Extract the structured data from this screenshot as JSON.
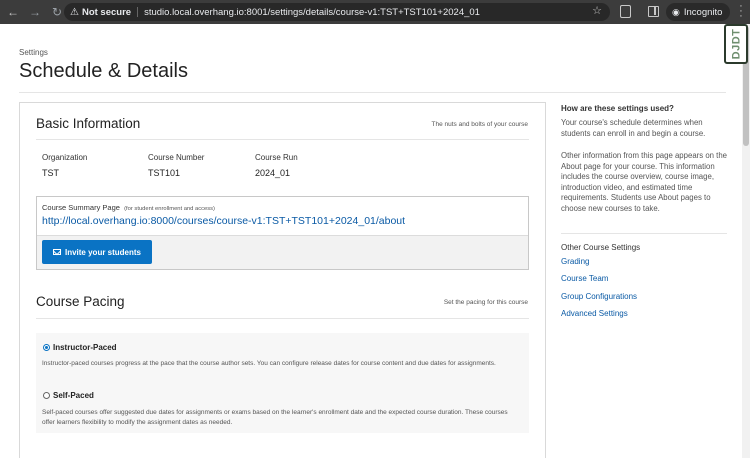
{
  "browser": {
    "security_label": "Not secure",
    "url": "studio.local.overhang.io:8001/settings/details/course-v1:TST+TST101+2024_01",
    "incognito_label": "Incognito"
  },
  "djdt": {
    "label": "DJDT"
  },
  "header": {
    "breadcrumb": "Settings",
    "title": "Schedule & Details"
  },
  "basic_info": {
    "title": "Basic Information",
    "subtitle": "The nuts and bolts of your course",
    "fields": [
      {
        "label": "Organization",
        "value": "TST"
      },
      {
        "label": "Course Number",
        "value": "TST101"
      },
      {
        "label": "Course Run",
        "value": "2024_01"
      }
    ],
    "summary_label": "Course Summary Page",
    "summary_note": "(for student enrollment and access)",
    "summary_url": "http://local.overhang.io:8000/courses/course-v1:TST+TST101+2024_01/about",
    "invite_label": "Invite your students"
  },
  "pacing": {
    "title": "Course Pacing",
    "subtitle": "Set the pacing for this course",
    "options": [
      {
        "label": "Instructor-Paced",
        "checked": true,
        "description": "Instructor-paced courses progress at the pace that the course author sets. You can configure release dates for course content and due dates for assignments."
      },
      {
        "label": "Self-Paced",
        "checked": false,
        "description": "Self-paced courses offer suggested due dates for assignments or exams based on the learner's enrollment date and the expected course duration. These courses offer learners flexibility to modify the assignment dates as needed."
      }
    ]
  },
  "sidebar": {
    "heading": "How are these settings used?",
    "para1": "Your course's schedule determines when students can enroll in and begin a course.",
    "para2": "Other information from this page appears on the About page for your course. This information includes the course overview, course image, introduction video, and estimated time requirements. Students use About pages to choose new courses to take.",
    "other_heading": "Other Course Settings",
    "links": [
      "Grading",
      "Course Team",
      "Group Configurations",
      "Advanced Settings"
    ]
  }
}
